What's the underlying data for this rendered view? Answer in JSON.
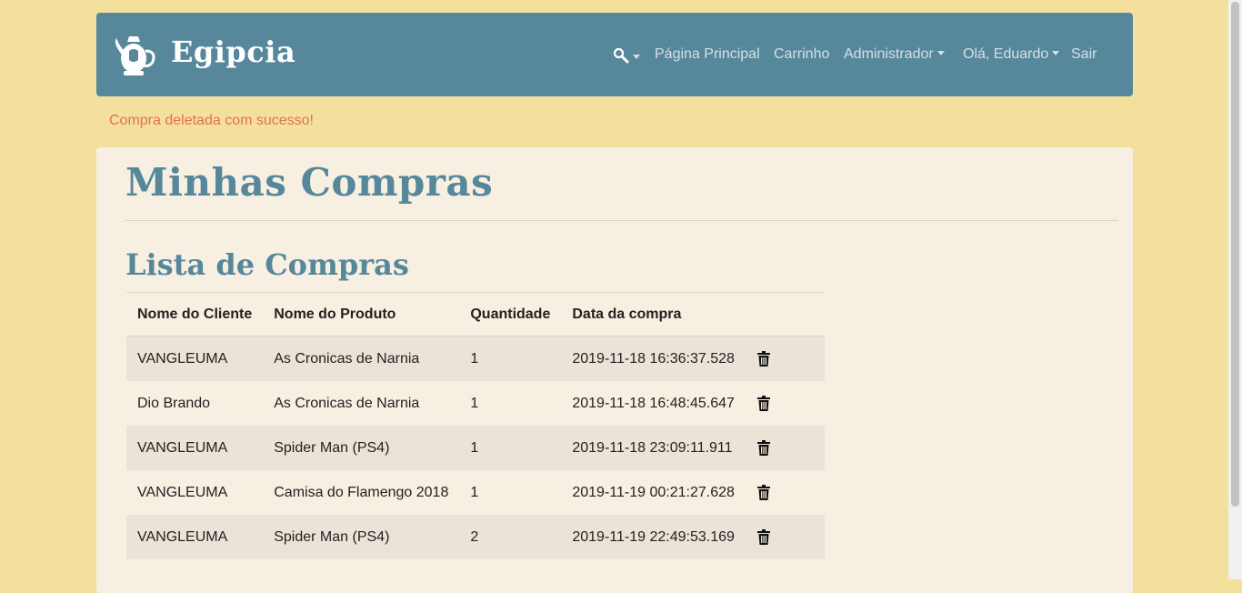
{
  "header": {
    "brand": "Egipcia",
    "nav": {
      "home": "Página Principal",
      "cart": "Carrinho",
      "admin": "Administrador",
      "greeting": "Olá, Eduardo",
      "logout": "Sair"
    },
    "icons": {
      "logo": "teapot-logo-icon",
      "search": "search-icon"
    }
  },
  "flash": {
    "message": "Compra deletada com sucesso!",
    "color": "#e36e5b"
  },
  "main": {
    "title": "Minhas Compras",
    "section_title": "Lista de Compras",
    "table": {
      "headers": [
        "Nome do Cliente",
        "Nome do Produto",
        "Quantidade",
        "Data da compra"
      ],
      "rows": [
        {
          "client": "VANGLEUMA",
          "product": "As Cronicas de Narnia",
          "qty": "1",
          "date": "2019-11-18 16:36:37.528"
        },
        {
          "client": "Dio Brando",
          "product": "As Cronicas de Narnia",
          "qty": "1",
          "date": "2019-11-18 16:48:45.647"
        },
        {
          "client": "VANGLEUMA",
          "product": "Spider Man (PS4)",
          "qty": "1",
          "date": "2019-11-18 23:09:11.911"
        },
        {
          "client": "VANGLEUMA",
          "product": "Camisa do Flamengo 2018",
          "qty": "1",
          "date": "2019-11-19 00:21:27.628"
        },
        {
          "client": "VANGLEUMA",
          "product": "Spider Man (PS4)",
          "qty": "2",
          "date": "2019-11-19 22:49:53.169"
        }
      ],
      "row_action_icon": "trash-icon"
    }
  },
  "colors": {
    "page_bg": "#f4e09d",
    "navbar_bg": "#57879b",
    "card_bg": "#f7efe1",
    "title_color": "#57879b",
    "striped_row": "#ebe3d7"
  }
}
